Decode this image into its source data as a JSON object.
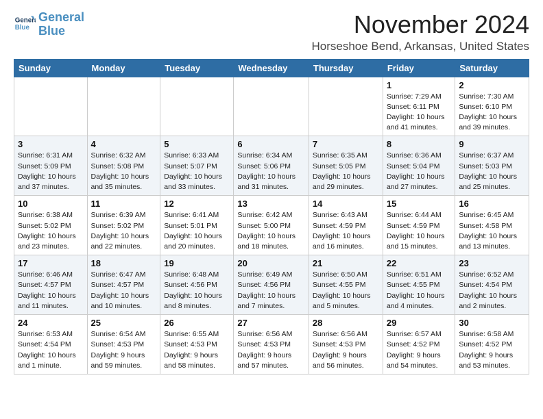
{
  "logo": {
    "line1": "General",
    "line2": "Blue"
  },
  "title": "November 2024",
  "location": "Horseshoe Bend, Arkansas, United States",
  "days_of_week": [
    "Sunday",
    "Monday",
    "Tuesday",
    "Wednesday",
    "Thursday",
    "Friday",
    "Saturday"
  ],
  "weeks": [
    [
      {
        "day": "",
        "info": ""
      },
      {
        "day": "",
        "info": ""
      },
      {
        "day": "",
        "info": ""
      },
      {
        "day": "",
        "info": ""
      },
      {
        "day": "",
        "info": ""
      },
      {
        "day": "1",
        "info": "Sunrise: 7:29 AM\nSunset: 6:11 PM\nDaylight: 10 hours\nand 41 minutes."
      },
      {
        "day": "2",
        "info": "Sunrise: 7:30 AM\nSunset: 6:10 PM\nDaylight: 10 hours\nand 39 minutes."
      }
    ],
    [
      {
        "day": "3",
        "info": "Sunrise: 6:31 AM\nSunset: 5:09 PM\nDaylight: 10 hours\nand 37 minutes."
      },
      {
        "day": "4",
        "info": "Sunrise: 6:32 AM\nSunset: 5:08 PM\nDaylight: 10 hours\nand 35 minutes."
      },
      {
        "day": "5",
        "info": "Sunrise: 6:33 AM\nSunset: 5:07 PM\nDaylight: 10 hours\nand 33 minutes."
      },
      {
        "day": "6",
        "info": "Sunrise: 6:34 AM\nSunset: 5:06 PM\nDaylight: 10 hours\nand 31 minutes."
      },
      {
        "day": "7",
        "info": "Sunrise: 6:35 AM\nSunset: 5:05 PM\nDaylight: 10 hours\nand 29 minutes."
      },
      {
        "day": "8",
        "info": "Sunrise: 6:36 AM\nSunset: 5:04 PM\nDaylight: 10 hours\nand 27 minutes."
      },
      {
        "day": "9",
        "info": "Sunrise: 6:37 AM\nSunset: 5:03 PM\nDaylight: 10 hours\nand 25 minutes."
      }
    ],
    [
      {
        "day": "10",
        "info": "Sunrise: 6:38 AM\nSunset: 5:02 PM\nDaylight: 10 hours\nand 23 minutes."
      },
      {
        "day": "11",
        "info": "Sunrise: 6:39 AM\nSunset: 5:02 PM\nDaylight: 10 hours\nand 22 minutes."
      },
      {
        "day": "12",
        "info": "Sunrise: 6:41 AM\nSunset: 5:01 PM\nDaylight: 10 hours\nand 20 minutes."
      },
      {
        "day": "13",
        "info": "Sunrise: 6:42 AM\nSunset: 5:00 PM\nDaylight: 10 hours\nand 18 minutes."
      },
      {
        "day": "14",
        "info": "Sunrise: 6:43 AM\nSunset: 4:59 PM\nDaylight: 10 hours\nand 16 minutes."
      },
      {
        "day": "15",
        "info": "Sunrise: 6:44 AM\nSunset: 4:59 PM\nDaylight: 10 hours\nand 15 minutes."
      },
      {
        "day": "16",
        "info": "Sunrise: 6:45 AM\nSunset: 4:58 PM\nDaylight: 10 hours\nand 13 minutes."
      }
    ],
    [
      {
        "day": "17",
        "info": "Sunrise: 6:46 AM\nSunset: 4:57 PM\nDaylight: 10 hours\nand 11 minutes."
      },
      {
        "day": "18",
        "info": "Sunrise: 6:47 AM\nSunset: 4:57 PM\nDaylight: 10 hours\nand 10 minutes."
      },
      {
        "day": "19",
        "info": "Sunrise: 6:48 AM\nSunset: 4:56 PM\nDaylight: 10 hours\nand 8 minutes."
      },
      {
        "day": "20",
        "info": "Sunrise: 6:49 AM\nSunset: 4:56 PM\nDaylight: 10 hours\nand 7 minutes."
      },
      {
        "day": "21",
        "info": "Sunrise: 6:50 AM\nSunset: 4:55 PM\nDaylight: 10 hours\nand 5 minutes."
      },
      {
        "day": "22",
        "info": "Sunrise: 6:51 AM\nSunset: 4:55 PM\nDaylight: 10 hours\nand 4 minutes."
      },
      {
        "day": "23",
        "info": "Sunrise: 6:52 AM\nSunset: 4:54 PM\nDaylight: 10 hours\nand 2 minutes."
      }
    ],
    [
      {
        "day": "24",
        "info": "Sunrise: 6:53 AM\nSunset: 4:54 PM\nDaylight: 10 hours\nand 1 minute."
      },
      {
        "day": "25",
        "info": "Sunrise: 6:54 AM\nSunset: 4:53 PM\nDaylight: 9 hours\nand 59 minutes."
      },
      {
        "day": "26",
        "info": "Sunrise: 6:55 AM\nSunset: 4:53 PM\nDaylight: 9 hours\nand 58 minutes."
      },
      {
        "day": "27",
        "info": "Sunrise: 6:56 AM\nSunset: 4:53 PM\nDaylight: 9 hours\nand 57 minutes."
      },
      {
        "day": "28",
        "info": "Sunrise: 6:56 AM\nSunset: 4:53 PM\nDaylight: 9 hours\nand 56 minutes."
      },
      {
        "day": "29",
        "info": "Sunrise: 6:57 AM\nSunset: 4:52 PM\nDaylight: 9 hours\nand 54 minutes."
      },
      {
        "day": "30",
        "info": "Sunrise: 6:58 AM\nSunset: 4:52 PM\nDaylight: 9 hours\nand 53 minutes."
      }
    ]
  ]
}
